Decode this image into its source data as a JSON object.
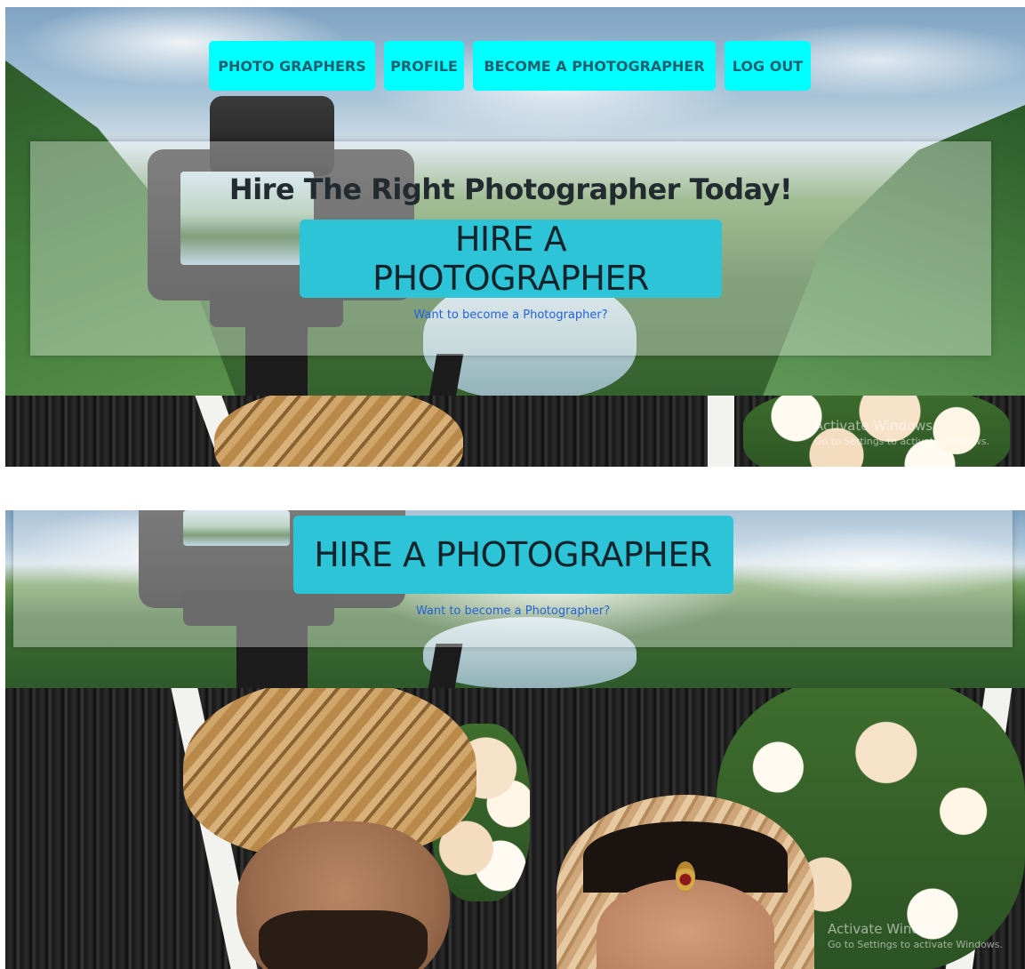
{
  "nav": {
    "items": [
      {
        "label": "PHOTO GRAPHERS"
      },
      {
        "label": "PROFILE"
      },
      {
        "label": "BECOME A PHOTOGRAPHER"
      },
      {
        "label": "LOG OUT"
      }
    ]
  },
  "hero": {
    "title": "Hire The Right Photographer Today!",
    "hire_button": "HIRE A PHOTOGRAPHER",
    "become_link": "Want to become a Photographer?"
  },
  "watermark": {
    "title": "Activate Windows",
    "subtitle": "Go to Settings to activate Windows."
  },
  "colors": {
    "nav_button_bg": "#00ffff",
    "nav_button_text": "#206070",
    "hire_button_bg": "#2cc4d6",
    "link": "#2463d8"
  }
}
